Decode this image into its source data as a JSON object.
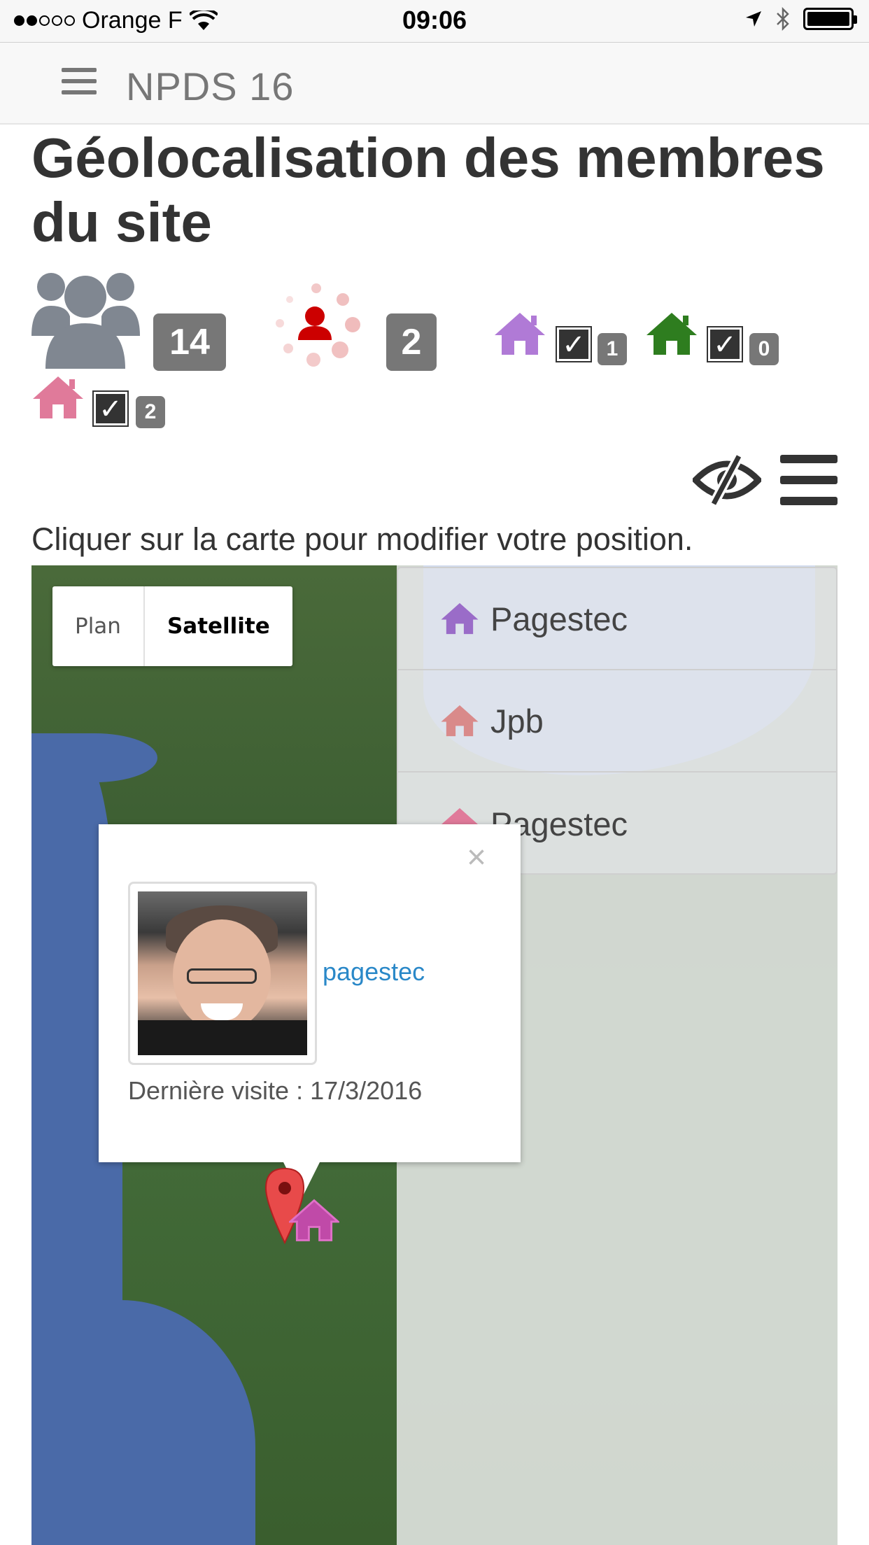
{
  "status_bar": {
    "carrier": "Orange F",
    "time": "09:06"
  },
  "navbar": {
    "brand": "NPDS  16"
  },
  "page": {
    "title": "Géolocalisation des membres du site",
    "hint": "Cliquer sur la carte pour modifier votre position."
  },
  "stats": {
    "members_count": "14",
    "online_count": "2",
    "filters": [
      {
        "color": "#b07ad6",
        "count": "1",
        "checked": true
      },
      {
        "color": "#2e7d1f",
        "count": "0",
        "checked": true
      },
      {
        "color": "#e07a9a",
        "count": "2",
        "checked": true
      }
    ],
    "check_glyph": "✓"
  },
  "map": {
    "map_type_plan": "Plan",
    "map_type_satellite": "Satellite",
    "legend": [
      {
        "label": "Pagestec",
        "color": "#9a6cc8"
      },
      {
        "label": "Jpb",
        "color": "#d98a8a"
      },
      {
        "label": "Pagestec",
        "color": "#e07a9a"
      }
    ],
    "popup": {
      "close": "×",
      "username": "pagestec",
      "last_visit": "Dernière visite : 17/3/2016"
    }
  },
  "colors": {
    "badge": "#777777",
    "online_red": "#cc0000",
    "link": "#2a88c8"
  },
  "icons": [
    "members-icon",
    "online-spinner-icon",
    "home-icon",
    "eye-slash-icon",
    "menu-icon",
    "map-marker-icon"
  ]
}
